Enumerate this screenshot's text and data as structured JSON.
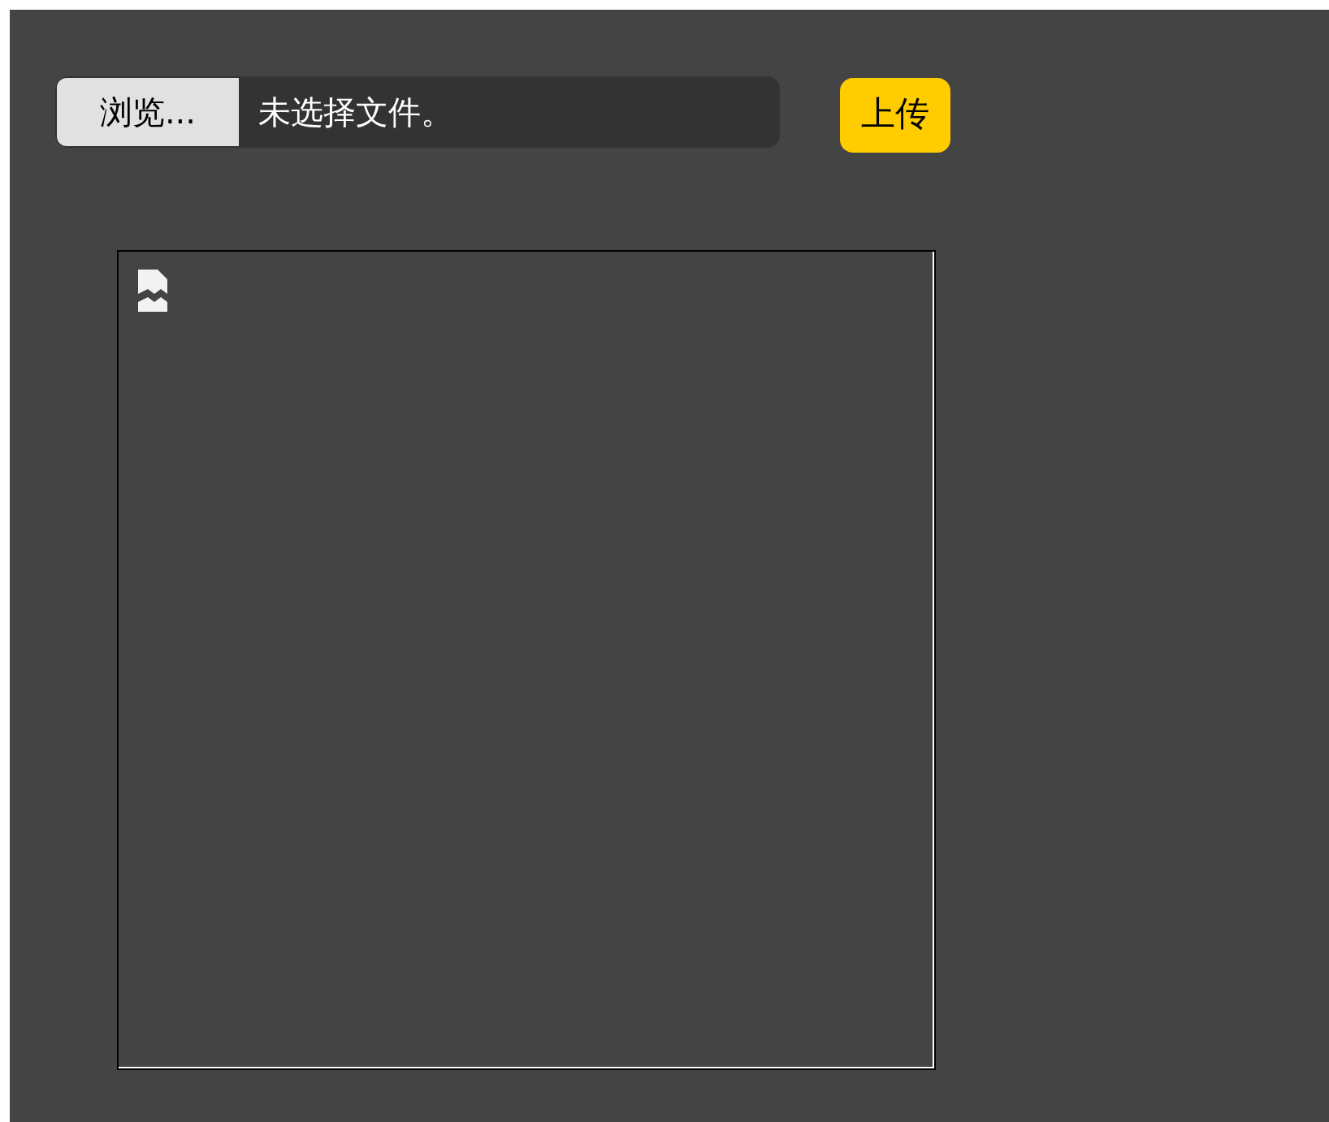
{
  "file_input": {
    "button": "浏览...",
    "status": "未选择文件。"
  },
  "upload_button": "上传",
  "image_preview": {
    "broken": true
  }
}
